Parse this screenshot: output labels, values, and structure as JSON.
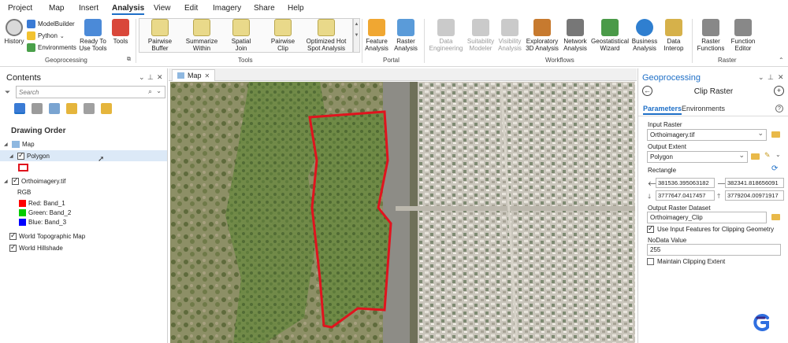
{
  "menu": [
    "Project",
    "Map",
    "Insert",
    "Analysis",
    "View",
    "Edit",
    "Imagery",
    "Share",
    "Help"
  ],
  "menu_active": "Analysis",
  "ribbon": {
    "geoprocessing": {
      "history": "History",
      "modelbuilder": "ModelBuilder",
      "python": "Python",
      "environments": "Environments",
      "ready_to_use": "Ready To Use Tools",
      "tools": "Tools",
      "label": "Geoprocessing"
    },
    "tools_gallery": [
      "Pairwise Buffer",
      "Summarize Within",
      "Spatial Join",
      "Pairwise Clip",
      "Optimized Hot Spot Analysis"
    ],
    "tools_label": "Tools",
    "portal": [
      "Feature Analysis",
      "Raster Analysis"
    ],
    "portal_label": "Portal",
    "workflows": [
      "Data Engineering",
      "Suitability Modeler",
      "Visibility Analysis",
      "Exploratory 3D Analysis",
      "Network Analysis",
      "Geostatistical Wizard",
      "Business Analysis",
      "Data Interop"
    ],
    "workflows_label": "Workflows",
    "raster": [
      "Raster Functions",
      "Function Editor"
    ],
    "raster_label": "Raster"
  },
  "contents": {
    "title": "Contents",
    "search_placeholder": "Search",
    "drawing_order": "Drawing Order",
    "map": "Map",
    "polygon": "Polygon",
    "ortho": "Orthoimagery.tif",
    "rgb": "RGB",
    "bands": [
      {
        "label": "Red:  Band_1",
        "color": "#ff0000"
      },
      {
        "label": "Green: Band_2",
        "color": "#00cc00"
      },
      {
        "label": "Blue:  Band_3",
        "color": "#0000ff"
      }
    ],
    "topo": "World Topographic Map",
    "hillshade": "World Hillshade"
  },
  "map_tab": "Map",
  "geoprocessing": {
    "title": "Geoprocessing",
    "tool_title": "Clip Raster",
    "tab_parameters": "Parameters",
    "tab_environments": "Environments",
    "input_raster_label": "Input Raster",
    "input_raster": "Orthoimagery.tif",
    "output_extent_label": "Output Extent",
    "output_extent": "Polygon",
    "rectangle_label": "Rectangle",
    "left": "381536.395063182",
    "right": "382341.818656091",
    "bottom": "3777647.0417457",
    "top": "3779204.00971917",
    "output_dataset_label": "Output Raster Dataset",
    "output_dataset": "Orthoimagery_Clip",
    "use_input_features": "Use Input Features for Clipping Geometry",
    "nodata_label": "NoData Value",
    "nodata": "255",
    "maintain_extent": "Maintain Clipping Extent"
  },
  "colors": {
    "accent": "#1e6fc7",
    "clip_polygon": "#e0141e",
    "selection": "#dce9f7"
  }
}
